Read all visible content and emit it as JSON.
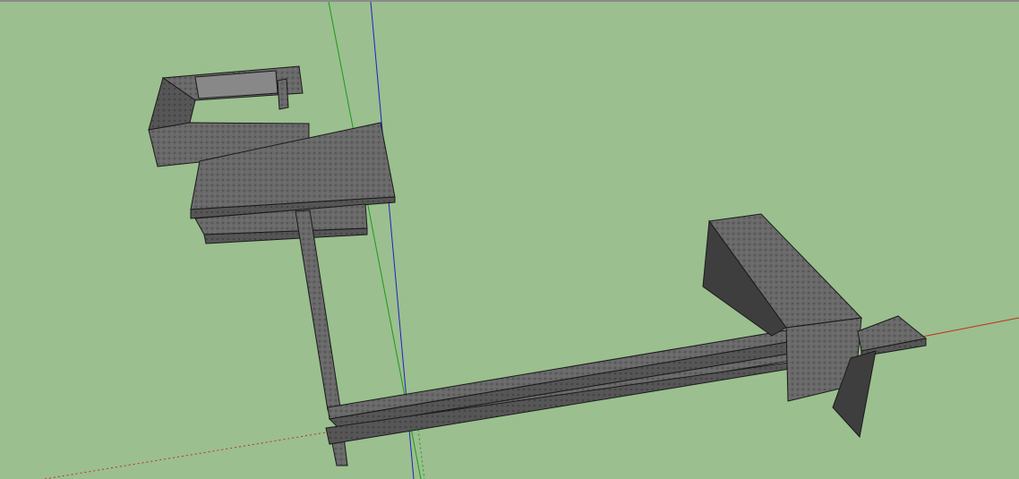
{
  "app": {
    "view": "3d-model-viewport",
    "background_color": "#9bbf8f"
  },
  "axes": {
    "red_axis_color": "#c03020",
    "green_axis_color": "#1a9a1a",
    "blue_axis_color": "#2020c0"
  },
  "model": {
    "face_light": "#6e6e6e",
    "face_mid": "#5a5a5a",
    "face_dark": "#3a3a3a",
    "edge_color": "#1a1a1a"
  }
}
